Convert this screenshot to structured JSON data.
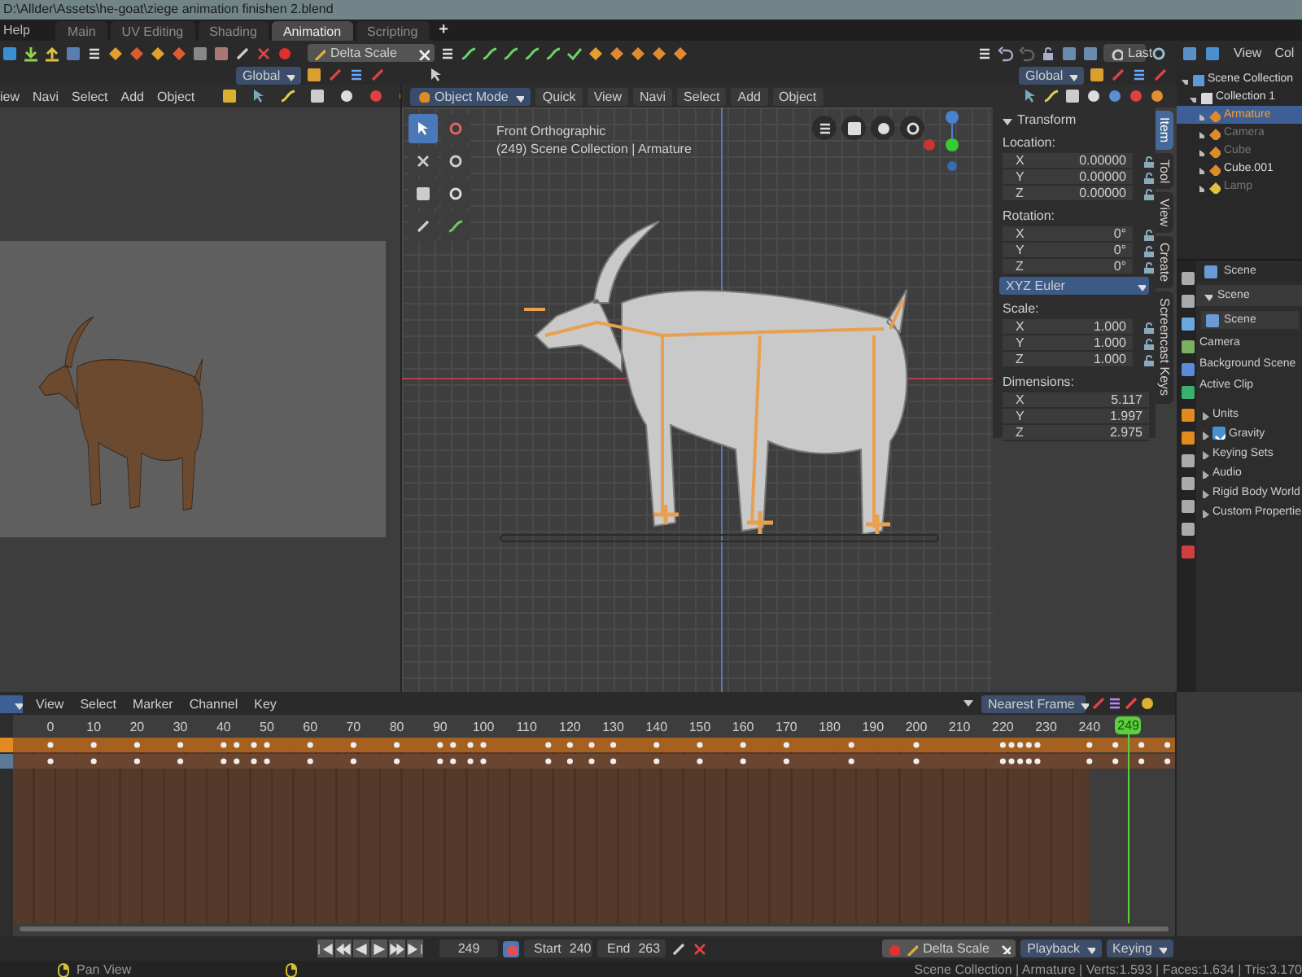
{
  "window": {
    "title": "D:\\Allder\\Assets\\he-goat\\ziege animation finishen 2.blend"
  },
  "menu": {
    "items": [
      "Help"
    ]
  },
  "workspace_tabs": [
    {
      "label": "Main",
      "selected": false
    },
    {
      "label": "UV Editing",
      "selected": false
    },
    {
      "label": "Shading",
      "selected": false
    },
    {
      "label": "Animation",
      "selected": true
    },
    {
      "label": "Scripting",
      "selected": false
    }
  ],
  "add_tab": "+",
  "toolbar": {
    "keying_set": "Delta Scale",
    "last_button": "Last",
    "editor_menu": [
      "View",
      "Col"
    ]
  },
  "orientation": {
    "left": "Global",
    "right": "Global"
  },
  "left_viewport": {
    "menu": [
      "iew",
      "Navi",
      "Select",
      "Add",
      "Object"
    ]
  },
  "main_viewport": {
    "mode": "Object Mode",
    "menu": [
      "Quick",
      "View",
      "Navi",
      "Select",
      "Add",
      "Object"
    ],
    "view_name": "Front Orthographic",
    "info": "(249) Scene Collection | Armature"
  },
  "transform_panel": {
    "title": "Transform",
    "groups": [
      {
        "label": "Location:",
        "lockable": true,
        "rows": [
          {
            "axis": "X",
            "value": "0.00000"
          },
          {
            "axis": "Y",
            "value": "0.00000"
          },
          {
            "axis": "Z",
            "value": "0.00000"
          }
        ]
      },
      {
        "label": "Rotation:",
        "lockable": true,
        "rows": [
          {
            "axis": "X",
            "value": "0°"
          },
          {
            "axis": "Y",
            "value": "0°"
          },
          {
            "axis": "Z",
            "value": "0°"
          }
        ],
        "mode": "XYZ Euler"
      },
      {
        "label": "Scale:",
        "lockable": true,
        "rows": [
          {
            "axis": "X",
            "value": "1.000"
          },
          {
            "axis": "Y",
            "value": "1.000"
          },
          {
            "axis": "Z",
            "value": "1.000"
          }
        ]
      },
      {
        "label": "Dimensions:",
        "lockable": false,
        "rows": [
          {
            "axis": "X",
            "value": "5.117"
          },
          {
            "axis": "Y",
            "value": "1.997"
          },
          {
            "axis": "Z",
            "value": "2.975"
          }
        ]
      }
    ]
  },
  "sidebar_tabs": [
    {
      "label": "Item",
      "selected": true
    },
    {
      "label": "Tool",
      "selected": false
    },
    {
      "label": "View",
      "selected": false
    },
    {
      "label": "Create",
      "selected": false
    },
    {
      "label": "Screencast Keys",
      "selected": false
    }
  ],
  "outliner": {
    "items": [
      {
        "label": "Scene Collection",
        "selected": false,
        "visible": true,
        "children": [
          {
            "label": "Collection 1",
            "selected": false,
            "visible": true,
            "children": [
              {
                "label": "Armature",
                "selected": true,
                "visible": true
              },
              {
                "label": "Camera",
                "selected": false,
                "visible": false
              },
              {
                "label": "Cube",
                "selected": false,
                "visible": false
              },
              {
                "label": "Cube.001",
                "selected": false,
                "visible": true
              },
              {
                "label": "Lamp",
                "selected": false,
                "visible": false
              }
            ]
          }
        ]
      }
    ]
  },
  "properties": {
    "header": "Scene",
    "panel": "Scene",
    "scene_field": "Scene",
    "fields": [
      "Camera",
      "Background Scene",
      "Active Clip"
    ],
    "subpanels": [
      {
        "kind": "panel",
        "label": "Units"
      },
      {
        "kind": "checkbox",
        "label": "Gravity",
        "checked": true
      },
      {
        "kind": "panel",
        "label": "Keying Sets"
      },
      {
        "kind": "panel",
        "label": "Audio"
      },
      {
        "kind": "panel",
        "label": "Rigid Body World"
      },
      {
        "kind": "panel",
        "label": "Custom Propertie"
      }
    ]
  },
  "timeline": {
    "menu": [
      "View",
      "Select",
      "Marker",
      "Channel",
      "Key"
    ],
    "snap": "Nearest Frame",
    "ruler": [
      "0",
      "10",
      "20",
      "30",
      "40",
      "50",
      "60",
      "70",
      "80",
      "90",
      "100",
      "110",
      "120",
      "130",
      "140",
      "150",
      "160",
      "170",
      "180",
      "190",
      "200",
      "210",
      "220",
      "230",
      "240"
    ],
    "current_frame": "249"
  },
  "playback": {
    "frame": "249",
    "start_label": "Start",
    "start": "240",
    "end_label": "End",
    "end": "263",
    "keying_set": "Delta Scale",
    "menus": [
      "Playback",
      "Keying"
    ]
  },
  "status_bar": {
    "hint": "Pan View",
    "stats": "Scene Collection | Armature | Verts:1.593 | Faces:1.634 | Tris:3.170"
  }
}
